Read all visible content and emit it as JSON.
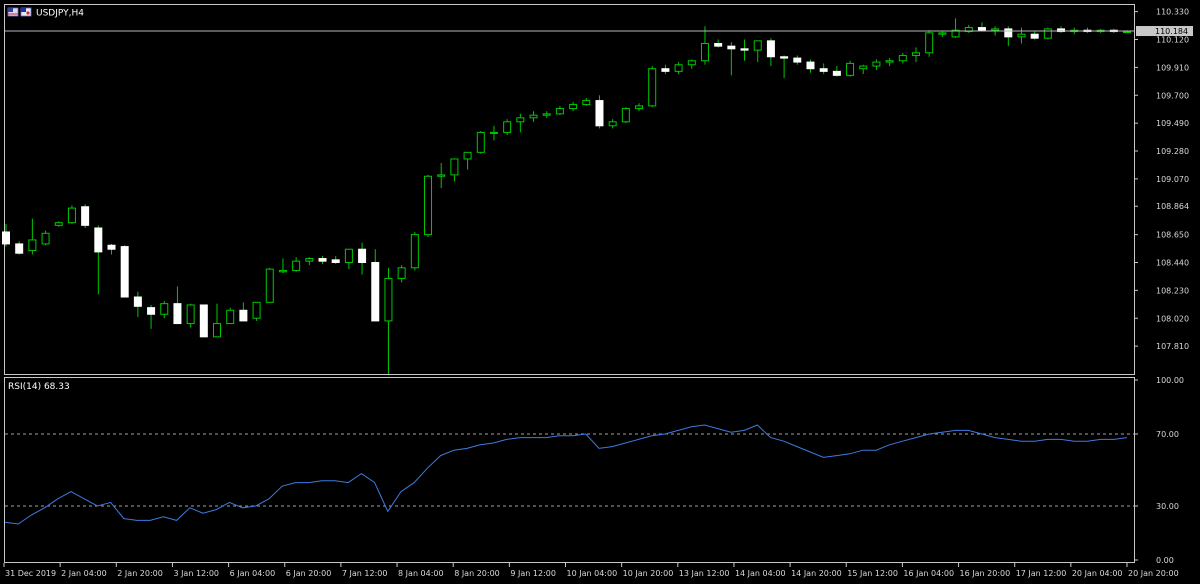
{
  "chart_data": [
    {
      "type": "candlestick",
      "title": "USDJPY,H4",
      "current_price": "110.184",
      "ylim": [
        107.6,
        110.38
      ],
      "y_ticks": [
        "110.330",
        "110.120",
        "109.910",
        "109.700",
        "109.490",
        "109.280",
        "109.070",
        "108.864",
        "108.650",
        "108.440",
        "108.230",
        "108.020",
        "107.810"
      ],
      "x_ticks": [
        "31 Dec 2019",
        "2 Jan 04:00",
        "2 Jan 20:00",
        "3 Jan 12:00",
        "6 Jan 04:00",
        "6 Jan 20:00",
        "7 Jan 12:00",
        "8 Jan 04:00",
        "8 Jan 20:00",
        "9 Jan 12:00",
        "10 Jan 04:00",
        "10 Jan 20:00",
        "13 Jan 12:00",
        "14 Jan 04:00",
        "14 Jan 20:00",
        "15 Jan 12:00",
        "16 Jan 04:00",
        "16 Jan 20:00",
        "17 Jan 12:00",
        "20 Jan 04:00",
        "20 Jan 20:00"
      ],
      "candles": [
        {
          "o": 108.67,
          "h": 108.73,
          "l": 108.56,
          "c": 108.58
        },
        {
          "o": 108.58,
          "h": 108.6,
          "l": 108.5,
          "c": 108.51
        },
        {
          "o": 108.53,
          "h": 108.77,
          "l": 108.5,
          "c": 108.61
        },
        {
          "o": 108.58,
          "h": 108.68,
          "l": 108.57,
          "c": 108.66
        },
        {
          "o": 108.72,
          "h": 108.75,
          "l": 108.71,
          "c": 108.74
        },
        {
          "o": 108.74,
          "h": 108.87,
          "l": 108.73,
          "c": 108.85
        },
        {
          "o": 108.86,
          "h": 108.88,
          "l": 108.7,
          "c": 108.72
        },
        {
          "o": 108.7,
          "h": 108.72,
          "l": 108.2,
          "c": 108.52
        },
        {
          "o": 108.57,
          "h": 108.58,
          "l": 108.5,
          "c": 108.54
        },
        {
          "o": 108.56,
          "h": 108.57,
          "l": 108.18,
          "c": 108.18
        },
        {
          "o": 108.18,
          "h": 108.22,
          "l": 108.03,
          "c": 108.11
        },
        {
          "o": 108.1,
          "h": 108.12,
          "l": 107.94,
          "c": 108.05
        },
        {
          "o": 108.05,
          "h": 108.15,
          "l": 108.02,
          "c": 108.13
        },
        {
          "o": 108.13,
          "h": 108.26,
          "l": 108.0,
          "c": 107.98
        },
        {
          "o": 107.98,
          "h": 108.13,
          "l": 107.95,
          "c": 108.12
        },
        {
          "o": 108.12,
          "h": 108.12,
          "l": 107.88,
          "c": 107.88
        },
        {
          "o": 107.88,
          "h": 108.13,
          "l": 107.88,
          "c": 107.98
        },
        {
          "o": 107.98,
          "h": 108.1,
          "l": 107.98,
          "c": 108.08
        },
        {
          "o": 108.08,
          "h": 108.14,
          "l": 108.0,
          "c": 108.0
        },
        {
          "o": 108.02,
          "h": 108.14,
          "l": 108.0,
          "c": 108.14
        },
        {
          "o": 108.14,
          "h": 108.4,
          "l": 108.14,
          "c": 108.39
        },
        {
          "o": 108.37,
          "h": 108.47,
          "l": 108.36,
          "c": 108.38
        },
        {
          "o": 108.38,
          "h": 108.48,
          "l": 108.37,
          "c": 108.45
        },
        {
          "o": 108.45,
          "h": 108.48,
          "l": 108.42,
          "c": 108.47
        },
        {
          "o": 108.47,
          "h": 108.49,
          "l": 108.43,
          "c": 108.45
        },
        {
          "o": 108.46,
          "h": 108.49,
          "l": 108.43,
          "c": 108.44
        },
        {
          "o": 108.44,
          "h": 108.49,
          "l": 108.39,
          "c": 108.54
        },
        {
          "o": 108.54,
          "h": 108.59,
          "l": 108.35,
          "c": 108.44
        },
        {
          "o": 108.44,
          "h": 108.54,
          "l": 108.0,
          "c": 108.0
        },
        {
          "o": 108.0,
          "h": 108.4,
          "l": 107.6,
          "c": 108.32
        },
        {
          "o": 108.32,
          "h": 108.42,
          "l": 108.29,
          "c": 108.4
        },
        {
          "o": 108.4,
          "h": 108.67,
          "l": 108.38,
          "c": 108.65
        },
        {
          "o": 108.65,
          "h": 109.1,
          "l": 108.63,
          "c": 109.09
        },
        {
          "o": 109.09,
          "h": 109.19,
          "l": 109.0,
          "c": 109.1
        },
        {
          "o": 109.1,
          "h": 109.22,
          "l": 109.05,
          "c": 109.22
        },
        {
          "o": 109.22,
          "h": 109.27,
          "l": 109.14,
          "c": 109.27
        },
        {
          "o": 109.27,
          "h": 109.43,
          "l": 109.26,
          "c": 109.42
        },
        {
          "o": 109.42,
          "h": 109.47,
          "l": 109.36,
          "c": 109.42
        },
        {
          "o": 109.42,
          "h": 109.52,
          "l": 109.4,
          "c": 109.5
        },
        {
          "o": 109.5,
          "h": 109.56,
          "l": 109.42,
          "c": 109.53
        },
        {
          "o": 109.53,
          "h": 109.58,
          "l": 109.5,
          "c": 109.55
        },
        {
          "o": 109.55,
          "h": 109.58,
          "l": 109.53,
          "c": 109.56
        },
        {
          "o": 109.56,
          "h": 109.62,
          "l": 109.55,
          "c": 109.6
        },
        {
          "o": 109.6,
          "h": 109.65,
          "l": 109.58,
          "c": 109.63
        },
        {
          "o": 109.63,
          "h": 109.68,
          "l": 109.62,
          "c": 109.66
        },
        {
          "o": 109.66,
          "h": 109.7,
          "l": 109.45,
          "c": 109.47
        },
        {
          "o": 109.47,
          "h": 109.52,
          "l": 109.45,
          "c": 109.5
        },
        {
          "o": 109.5,
          "h": 109.61,
          "l": 109.49,
          "c": 109.6
        },
        {
          "o": 109.6,
          "h": 109.64,
          "l": 109.58,
          "c": 109.62
        },
        {
          "o": 109.62,
          "h": 109.92,
          "l": 109.61,
          "c": 109.9
        },
        {
          "o": 109.9,
          "h": 109.93,
          "l": 109.86,
          "c": 109.88
        },
        {
          "o": 109.88,
          "h": 109.95,
          "l": 109.86,
          "c": 109.93
        },
        {
          "o": 109.93,
          "h": 109.97,
          "l": 109.9,
          "c": 109.96
        },
        {
          "o": 109.96,
          "h": 110.22,
          "l": 109.93,
          "c": 110.09
        },
        {
          "o": 110.09,
          "h": 110.12,
          "l": 110.06,
          "c": 110.07
        },
        {
          "o": 110.07,
          "h": 110.1,
          "l": 109.85,
          "c": 110.05
        },
        {
          "o": 110.05,
          "h": 110.12,
          "l": 109.96,
          "c": 110.04
        },
        {
          "o": 110.04,
          "h": 110.11,
          "l": 109.95,
          "c": 110.11
        },
        {
          "o": 110.11,
          "h": 110.13,
          "l": 109.92,
          "c": 109.99
        },
        {
          "o": 109.99,
          "h": 110.0,
          "l": 109.83,
          "c": 109.98
        },
        {
          "o": 109.98,
          "h": 110.0,
          "l": 109.93,
          "c": 109.95
        },
        {
          "o": 109.95,
          "h": 109.97,
          "l": 109.87,
          "c": 109.9
        },
        {
          "o": 109.9,
          "h": 109.94,
          "l": 109.86,
          "c": 109.88
        },
        {
          "o": 109.88,
          "h": 109.92,
          "l": 109.84,
          "c": 109.85
        },
        {
          "o": 109.85,
          "h": 109.96,
          "l": 109.84,
          "c": 109.94
        },
        {
          "o": 109.9,
          "h": 109.93,
          "l": 109.86,
          "c": 109.92
        },
        {
          "o": 109.92,
          "h": 109.97,
          "l": 109.89,
          "c": 109.95
        },
        {
          "o": 109.95,
          "h": 109.98,
          "l": 109.92,
          "c": 109.96
        },
        {
          "o": 109.96,
          "h": 110.02,
          "l": 109.94,
          "c": 110.0
        },
        {
          "o": 110.0,
          "h": 110.06,
          "l": 109.95,
          "c": 110.02
        },
        {
          "o": 110.02,
          "h": 110.19,
          "l": 109.99,
          "c": 110.17
        },
        {
          "o": 110.16,
          "h": 110.18,
          "l": 110.14,
          "c": 110.17
        },
        {
          "o": 110.14,
          "h": 110.28,
          "l": 110.13,
          "c": 110.19
        },
        {
          "o": 110.18,
          "h": 110.23,
          "l": 110.17,
          "c": 110.21
        },
        {
          "o": 110.21,
          "h": 110.25,
          "l": 110.18,
          "c": 110.19
        },
        {
          "o": 110.19,
          "h": 110.22,
          "l": 110.15,
          "c": 110.2
        },
        {
          "o": 110.2,
          "h": 110.22,
          "l": 110.07,
          "c": 110.14
        },
        {
          "o": 110.14,
          "h": 110.21,
          "l": 110.09,
          "c": 110.16
        },
        {
          "o": 110.16,
          "h": 110.18,
          "l": 110.12,
          "c": 110.13
        },
        {
          "o": 110.13,
          "h": 110.21,
          "l": 110.12,
          "c": 110.2
        },
        {
          "o": 110.2,
          "h": 110.22,
          "l": 110.17,
          "c": 110.18
        },
        {
          "o": 110.18,
          "h": 110.21,
          "l": 110.16,
          "c": 110.19
        },
        {
          "o": 110.19,
          "h": 110.21,
          "l": 110.17,
          "c": 110.18
        },
        {
          "o": 110.18,
          "h": 110.2,
          "l": 110.17,
          "c": 110.19
        },
        {
          "o": 110.19,
          "h": 110.2,
          "l": 110.17,
          "c": 110.18
        },
        {
          "o": 110.18,
          "h": 110.19,
          "l": 110.17,
          "c": 110.18
        }
      ]
    },
    {
      "type": "line",
      "title": "RSI(14) 68.33",
      "ylim": [
        0,
        100
      ],
      "y_ticks": [
        "100.00",
        "70.00",
        "30.00",
        "0.00"
      ],
      "levels": [
        70,
        30
      ],
      "series": [
        {
          "color": "#3d7be0",
          "values": [
            21,
            20,
            25,
            29,
            34,
            38,
            34,
            30,
            32,
            23,
            22,
            22,
            24,
            22,
            29,
            26,
            28,
            32,
            29,
            30,
            34,
            41,
            43,
            43,
            44,
            44,
            43,
            48,
            43,
            27,
            38,
            43,
            51,
            58,
            61,
            62,
            64,
            65,
            67,
            68,
            68,
            68,
            69,
            69,
            70,
            62,
            63,
            65,
            67,
            69,
            70,
            72,
            74,
            75,
            73,
            71,
            72,
            75,
            68,
            66,
            63,
            60,
            57,
            58,
            59,
            61,
            61,
            64,
            66,
            68,
            70,
            71,
            72,
            72,
            70,
            68,
            67,
            66,
            66,
            67,
            67,
            66,
            66,
            67,
            67,
            68
          ]
        }
      ]
    }
  ],
  "colors": {
    "background": "#000000",
    "bull_body": "#000000",
    "bull_outline": "#00c800",
    "bear_body": "#ffffff",
    "bear_outline": "#ffffff",
    "wick": "#00c800",
    "grid_dash": "#a0a0a0",
    "frame": "#c8c8c8",
    "rsi_line": "#3d7be0",
    "price_line": "#b8b8b8"
  },
  "icons": [
    "flag-icon-1",
    "flag-icon-2"
  ]
}
